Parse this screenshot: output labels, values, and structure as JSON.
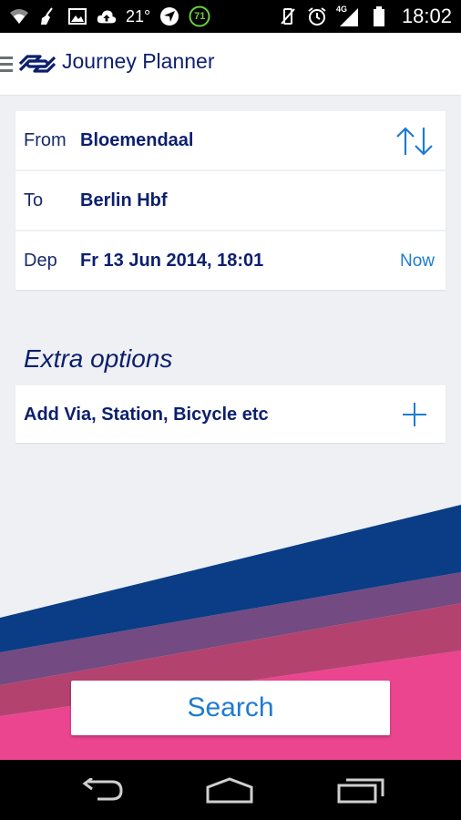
{
  "status_bar": {
    "temperature": "21°",
    "badge_number": "71",
    "network": "4G",
    "time": "18:02"
  },
  "app_bar": {
    "title": "Journey Planner"
  },
  "journey": {
    "from_label": "From",
    "from_value": "Bloemendaal",
    "to_label": "To",
    "to_value": "Berlin Hbf",
    "dep_label": "Dep",
    "dep_value": "Fr 13 Jun 2014, 18:01",
    "now_label": "Now"
  },
  "extra": {
    "heading": "Extra options",
    "add_via_label": "Add Via, Station, Bicycle etc"
  },
  "search": {
    "label": "Search"
  },
  "colors": {
    "brand_dark": "#0c1f6e",
    "accent_blue": "#1f7bd1",
    "stripe_navy": "#0a3d86",
    "stripe_purple": "#744a82",
    "stripe_mauve": "#b3426f",
    "stripe_pink": "#ec4590"
  }
}
